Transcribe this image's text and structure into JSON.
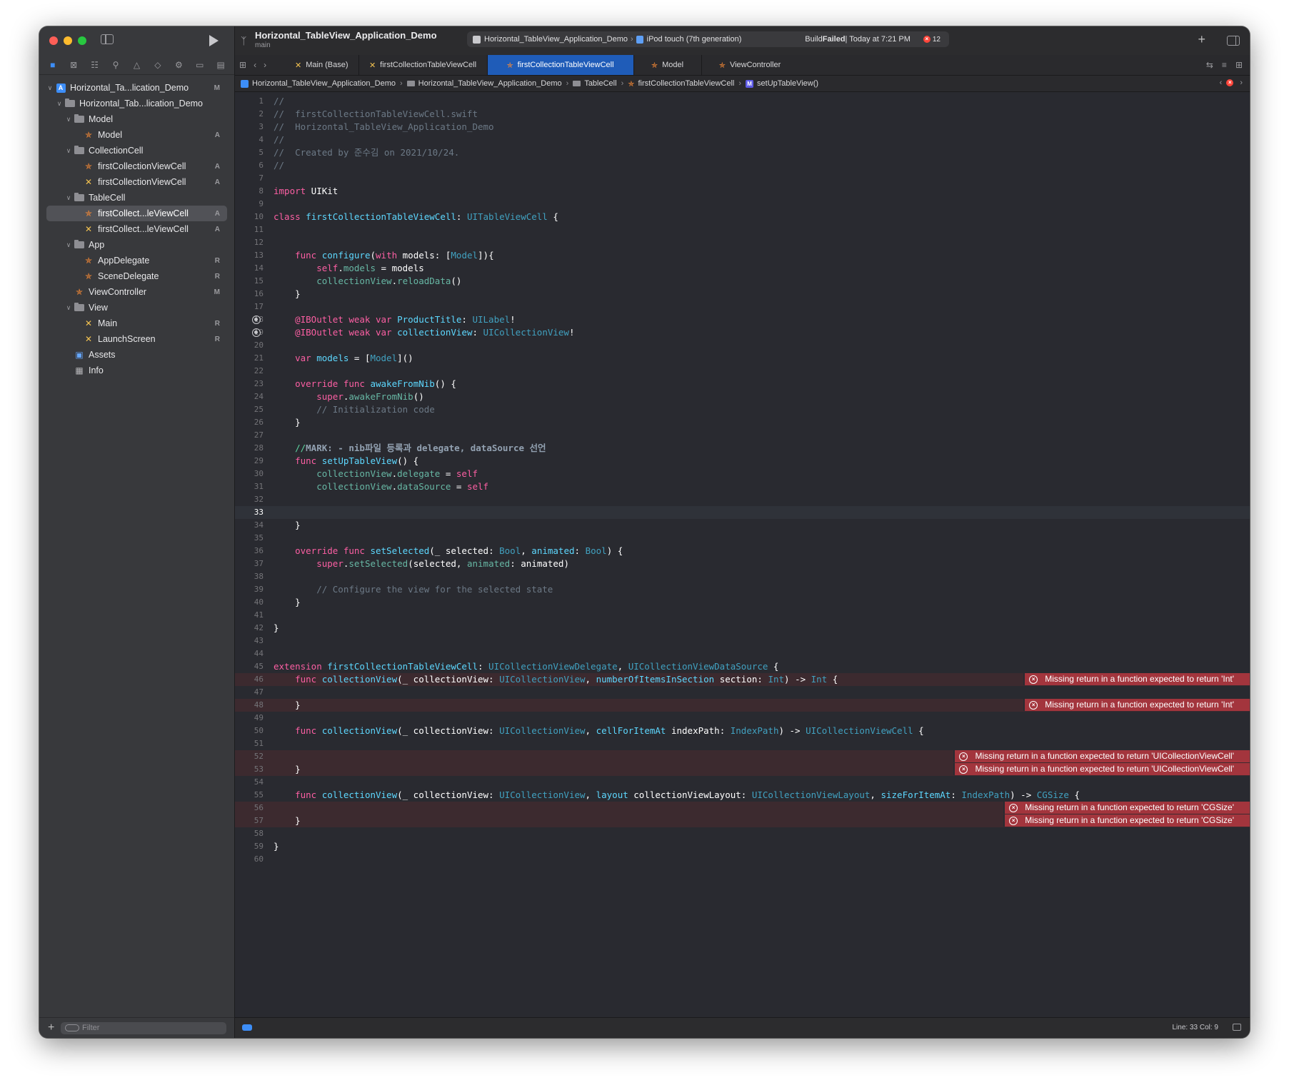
{
  "sidebar": {
    "nav_icons": [
      "folder-icon",
      "source-control-icon",
      "symbol-icon",
      "find-icon",
      "issue-icon",
      "test-icon",
      "debug-icon",
      "breakpoint-icon",
      "report-icon"
    ],
    "tree": [
      {
        "label": "Horizontal_Ta...lication_Demo",
        "badge": "M",
        "indent": 0,
        "kind": "project",
        "disc": "v"
      },
      {
        "label": "Horizontal_Tab...lication_Demo",
        "badge": "",
        "indent": 1,
        "kind": "folder",
        "disc": "v"
      },
      {
        "label": "Model",
        "badge": "",
        "indent": 2,
        "kind": "folder",
        "disc": "v"
      },
      {
        "label": "Model",
        "badge": "A",
        "indent": 3,
        "kind": "swift",
        "disc": ""
      },
      {
        "label": "CollectionCell",
        "badge": "",
        "indent": 2,
        "kind": "folder",
        "disc": "v"
      },
      {
        "label": "firstCollectionViewCell",
        "badge": "A",
        "indent": 3,
        "kind": "swift",
        "disc": ""
      },
      {
        "label": "firstCollectionViewCell",
        "badge": "A",
        "indent": 3,
        "kind": "xib",
        "disc": ""
      },
      {
        "label": "TableCell",
        "badge": "",
        "indent": 2,
        "kind": "folder",
        "disc": "v"
      },
      {
        "label": "firstCollect...leViewCell",
        "badge": "A",
        "indent": 3,
        "kind": "swift",
        "disc": "",
        "selected": true
      },
      {
        "label": "firstCollect...leViewCell",
        "badge": "A",
        "indent": 3,
        "kind": "xib",
        "disc": ""
      },
      {
        "label": "App",
        "badge": "",
        "indent": 2,
        "kind": "folder",
        "disc": "v"
      },
      {
        "label": "AppDelegate",
        "badge": "R",
        "indent": 3,
        "kind": "swift",
        "disc": ""
      },
      {
        "label": "SceneDelegate",
        "badge": "R",
        "indent": 3,
        "kind": "swift",
        "disc": ""
      },
      {
        "label": "ViewController",
        "badge": "M",
        "indent": 2,
        "kind": "swift",
        "disc": ""
      },
      {
        "label": "View",
        "badge": "",
        "indent": 2,
        "kind": "folder",
        "disc": "v"
      },
      {
        "label": "Main",
        "badge": "R",
        "indent": 3,
        "kind": "xib",
        "disc": ""
      },
      {
        "label": "LaunchScreen",
        "badge": "R",
        "indent": 3,
        "kind": "xib",
        "disc": ""
      },
      {
        "label": "Assets",
        "badge": "",
        "indent": 2,
        "kind": "assets",
        "disc": ""
      },
      {
        "label": "Info",
        "badge": "",
        "indent": 2,
        "kind": "info",
        "disc": ""
      }
    ],
    "filter_placeholder": "Filter"
  },
  "toolbar": {
    "project_title": "Horizontal_TableView_Application_Demo",
    "branch": "main",
    "scheme": "Horizontal_TableView_Application_Demo",
    "device": "iPod touch (7th generation)",
    "status_prefix": "Build ",
    "status_bold": "Failed",
    "status_suffix": " | Today at 7:21 PM",
    "error_count": "12"
  },
  "tabs": [
    {
      "label": "Main (Base)",
      "kind": "xib",
      "active": false
    },
    {
      "label": "firstCollectionTableViewCell",
      "kind": "xib",
      "active": false
    },
    {
      "label": "firstCollectionTableViewCell",
      "kind": "swift",
      "active": true
    },
    {
      "label": "Model",
      "kind": "swift",
      "active": false
    },
    {
      "label": "ViewController",
      "kind": "swift",
      "active": false
    }
  ],
  "jumpbar": {
    "project": "Horizontal_TableView_Application_Demo",
    "group": "Horizontal_TableView_Application_Demo",
    "folder": "TableCell",
    "file": "firstCollectionTableViewCell",
    "method": "setUpTableView()"
  },
  "editor": {
    "current_line": 33,
    "lines": [
      [
        [
          "c",
          "//"
        ]
      ],
      [
        [
          "c",
          "//  firstCollectionTableViewCell.swift"
        ]
      ],
      [
        [
          "c",
          "//  Horizontal_TableView_Application_Demo"
        ]
      ],
      [
        [
          "c",
          "//"
        ]
      ],
      [
        [
          "c",
          "//  Created by 준수김 on 2021/10/24."
        ]
      ],
      [
        [
          "c",
          "//"
        ]
      ],
      [],
      [
        [
          "k",
          "import"
        ],
        [
          "p",
          " UIKit"
        ]
      ],
      [],
      [
        [
          "k",
          "class"
        ],
        [
          "p",
          " "
        ],
        [
          "t",
          "firstCollectionTableViewCell"
        ],
        [
          "p",
          ": "
        ],
        [
          "ty",
          "UITableViewCell"
        ],
        [
          "p",
          " {"
        ]
      ],
      [],
      [],
      [
        [
          "p",
          "    "
        ],
        [
          "k",
          "func"
        ],
        [
          "p",
          " "
        ],
        [
          "t",
          "configure"
        ],
        [
          "p",
          "("
        ],
        [
          "k",
          "with"
        ],
        [
          "p",
          " models: ["
        ],
        [
          "ty",
          "Model"
        ],
        [
          "p",
          "]){"
        ]
      ],
      [
        [
          "p",
          "        "
        ],
        [
          "k",
          "self"
        ],
        [
          "p",
          "."
        ],
        [
          "f",
          "models"
        ],
        [
          "p",
          " = models"
        ]
      ],
      [
        [
          "p",
          "        "
        ],
        [
          "f",
          "collectionView"
        ],
        [
          "p",
          "."
        ],
        [
          "f",
          "reloadData"
        ],
        [
          "p",
          "()"
        ]
      ],
      [
        [
          "p",
          "    }"
        ]
      ],
      [],
      [
        [
          "k",
          "    @IBOutlet weak var"
        ],
        [
          "p",
          " "
        ],
        [
          "t",
          "ProductTitle"
        ],
        [
          "p",
          ": "
        ],
        [
          "ty",
          "UILabel"
        ],
        [
          "p",
          "!"
        ]
      ],
      [
        [
          "k",
          "    @IBOutlet weak var"
        ],
        [
          "p",
          " "
        ],
        [
          "t",
          "collectionView"
        ],
        [
          "p",
          ": "
        ],
        [
          "ty",
          "UICollectionView"
        ],
        [
          "p",
          "!"
        ]
      ],
      [],
      [
        [
          "p",
          "    "
        ],
        [
          "k",
          "var"
        ],
        [
          "p",
          " "
        ],
        [
          "t",
          "models"
        ],
        [
          "p",
          " = ["
        ],
        [
          "ty",
          "Model"
        ],
        [
          "p",
          "]()"
        ]
      ],
      [],
      [
        [
          "p",
          "    "
        ],
        [
          "k",
          "override func"
        ],
        [
          "p",
          " "
        ],
        [
          "t",
          "awakeFromNib"
        ],
        [
          "p",
          "() {"
        ]
      ],
      [
        [
          "p",
          "        "
        ],
        [
          "k",
          "super"
        ],
        [
          "p",
          "."
        ],
        [
          "f",
          "awakeFromNib"
        ],
        [
          "p",
          "()"
        ]
      ],
      [
        [
          "c",
          "        // Initialization code"
        ]
      ],
      [
        [
          "p",
          "    }"
        ]
      ],
      [],
      [
        [
          "cg",
          "    //"
        ],
        [
          "mk",
          "MARK: - nib파일 등록과 delegate, dataSource 선언"
        ]
      ],
      [
        [
          "p",
          "    "
        ],
        [
          "k",
          "func"
        ],
        [
          "p",
          " "
        ],
        [
          "t",
          "setUpTableView"
        ],
        [
          "p",
          "() {"
        ]
      ],
      [
        [
          "p",
          "        "
        ],
        [
          "f",
          "collectionView"
        ],
        [
          "p",
          "."
        ],
        [
          "f",
          "delegate"
        ],
        [
          "p",
          " = "
        ],
        [
          "k",
          "self"
        ]
      ],
      [
        [
          "p",
          "        "
        ],
        [
          "f",
          "collectionView"
        ],
        [
          "p",
          "."
        ],
        [
          "f",
          "dataSource"
        ],
        [
          "p",
          " = "
        ],
        [
          "k",
          "self"
        ]
      ],
      [],
      [],
      [
        [
          "p",
          "    }"
        ]
      ],
      [],
      [
        [
          "p",
          "    "
        ],
        [
          "k",
          "override func"
        ],
        [
          "p",
          " "
        ],
        [
          "t",
          "setSelected"
        ],
        [
          "p",
          "(_ selected: "
        ],
        [
          "ty",
          "Bool"
        ],
        [
          "p",
          ", "
        ],
        [
          "t",
          "animated"
        ],
        [
          "p",
          ": "
        ],
        [
          "ty",
          "Bool"
        ],
        [
          "p",
          ") {"
        ]
      ],
      [
        [
          "p",
          "        "
        ],
        [
          "k",
          "super"
        ],
        [
          "p",
          "."
        ],
        [
          "f",
          "setSelected"
        ],
        [
          "p",
          "(selected, "
        ],
        [
          "f",
          "animated"
        ],
        [
          "p",
          ": animated)"
        ]
      ],
      [],
      [
        [
          "c",
          "        // Configure the view for the selected state"
        ]
      ],
      [
        [
          "p",
          "    }"
        ]
      ],
      [],
      [
        [
          "p",
          "}"
        ]
      ],
      [],
      [],
      [
        [
          "k",
          "extension"
        ],
        [
          "p",
          " "
        ],
        [
          "t",
          "firstCollectionTableViewCell"
        ],
        [
          "p",
          ": "
        ],
        [
          "ty",
          "UICollectionViewDelegate"
        ],
        [
          "p",
          ", "
        ],
        [
          "ty",
          "UICollectionViewDataSource"
        ],
        [
          "p",
          " {"
        ]
      ],
      [
        [
          "p",
          "    "
        ],
        [
          "k",
          "func"
        ],
        [
          "p",
          " "
        ],
        [
          "t",
          "collectionView"
        ],
        [
          "p",
          "(_ collectionView: "
        ],
        [
          "ty",
          "UICollectionView"
        ],
        [
          "p",
          ", "
        ],
        [
          "t",
          "numberOfItemsInSection"
        ],
        [
          "p",
          " section: "
        ],
        [
          "ty",
          "Int"
        ],
        [
          "p",
          ") -> "
        ],
        [
          "ty",
          "Int"
        ],
        [
          "p",
          " {"
        ]
      ],
      [],
      [
        [
          "p",
          "    }"
        ]
      ],
      [],
      [
        [
          "p",
          "    "
        ],
        [
          "k",
          "func"
        ],
        [
          "p",
          " "
        ],
        [
          "t",
          "collectionView"
        ],
        [
          "p",
          "(_ collectionView: "
        ],
        [
          "ty",
          "UICollectionView"
        ],
        [
          "p",
          ", "
        ],
        [
          "t",
          "cellForItemAt"
        ],
        [
          "p",
          " indexPath: "
        ],
        [
          "ty",
          "IndexPath"
        ],
        [
          "p",
          ") -> "
        ],
        [
          "ty",
          "UICollectionViewCell"
        ],
        [
          "p",
          " {"
        ]
      ],
      [],
      [],
      [
        [
          "p",
          "    }"
        ]
      ],
      [],
      [
        [
          "p",
          "    "
        ],
        [
          "k",
          "func"
        ],
        [
          "p",
          " "
        ],
        [
          "t",
          "collectionView"
        ],
        [
          "p",
          "(_ collectionView: "
        ],
        [
          "ty",
          "UICollectionView"
        ],
        [
          "p",
          ", "
        ],
        [
          "t",
          "layout"
        ],
        [
          "p",
          " collectionViewLayout: "
        ],
        [
          "ty",
          "UICollectionViewLayout"
        ],
        [
          "p",
          ", "
        ],
        [
          "t",
          "sizeForItemAt"
        ],
        [
          "p",
          ": "
        ],
        [
          "ty",
          "IndexPath"
        ],
        [
          "p",
          ") -> "
        ],
        [
          "ty",
          "CGSize"
        ],
        [
          "p",
          " {"
        ]
      ],
      [],
      [
        [
          "p",
          "    }"
        ]
      ],
      [],
      [
        [
          "p",
          "}"
        ]
      ],
      []
    ],
    "outlet_lines": [
      18,
      19
    ],
    "error_lines": [
      46,
      48,
      52,
      53,
      56,
      57
    ],
    "errors": [
      {
        "line": 46,
        "text": "Missing return in a function expected to return 'Int'"
      },
      {
        "line": 48,
        "text": "Missing return in a function expected to return 'Int'"
      },
      {
        "line": 52,
        "text": "Missing return in a function expected to return 'UICollectionViewCell'"
      },
      {
        "line": 53,
        "text": "Missing return in a function expected to return 'UICollectionViewCell'"
      },
      {
        "line": 56,
        "text": "Missing return in a function expected to return 'CGSize'"
      },
      {
        "line": 57,
        "text": "Missing return in a function expected to return 'CGSize'"
      }
    ]
  },
  "statusbar": {
    "cursor": "Line: 33  Col: 9"
  },
  "colors": {
    "accent": "#3d8ef8",
    "error": "#a3353d",
    "editor_bg": "#292a30"
  }
}
